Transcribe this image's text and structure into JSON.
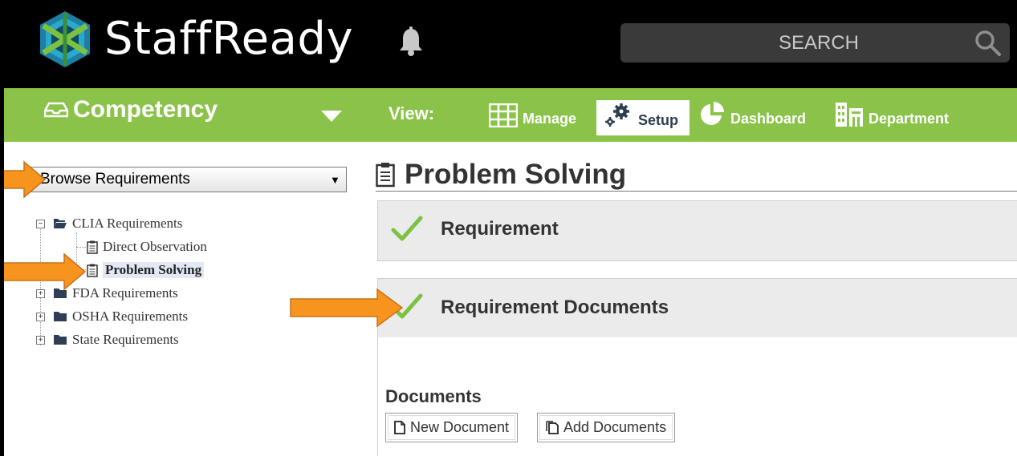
{
  "app": {
    "name": "StaffReady",
    "search_placeholder": "SEARCH"
  },
  "nav": {
    "module": "Competency",
    "view_label": "View:",
    "items": [
      {
        "label": "Manage",
        "icon": "grid-icon",
        "active": false
      },
      {
        "label": "Setup",
        "icon": "gears-icon",
        "active": true
      },
      {
        "label": "Dashboard",
        "icon": "pie-chart-icon",
        "active": false
      },
      {
        "label": "Department",
        "icon": "building-icon",
        "active": false
      }
    ]
  },
  "sidebar": {
    "browse_select": "Browse Requirements",
    "tree": [
      {
        "label": "CLIA Requirements",
        "expanded": true,
        "children": [
          {
            "label": "Direct Observation",
            "selected": false
          },
          {
            "label": "Problem Solving",
            "selected": true
          }
        ]
      },
      {
        "label": "FDA Requirements",
        "expanded": false
      },
      {
        "label": "OSHA Requirements",
        "expanded": false
      },
      {
        "label": "State Requirements",
        "expanded": false
      }
    ]
  },
  "main": {
    "title": "Problem Solving",
    "panels": [
      {
        "label": "Requirement",
        "status": "check"
      },
      {
        "label": "Requirement Documents",
        "status": "check"
      }
    ],
    "documents": {
      "heading": "Documents",
      "buttons": [
        "New Document",
        "Add Documents"
      ]
    }
  },
  "colors": {
    "topbar": "#000000",
    "navbar": "#8bc34a",
    "arrow": "#f7941d",
    "check": "#7dc142"
  }
}
